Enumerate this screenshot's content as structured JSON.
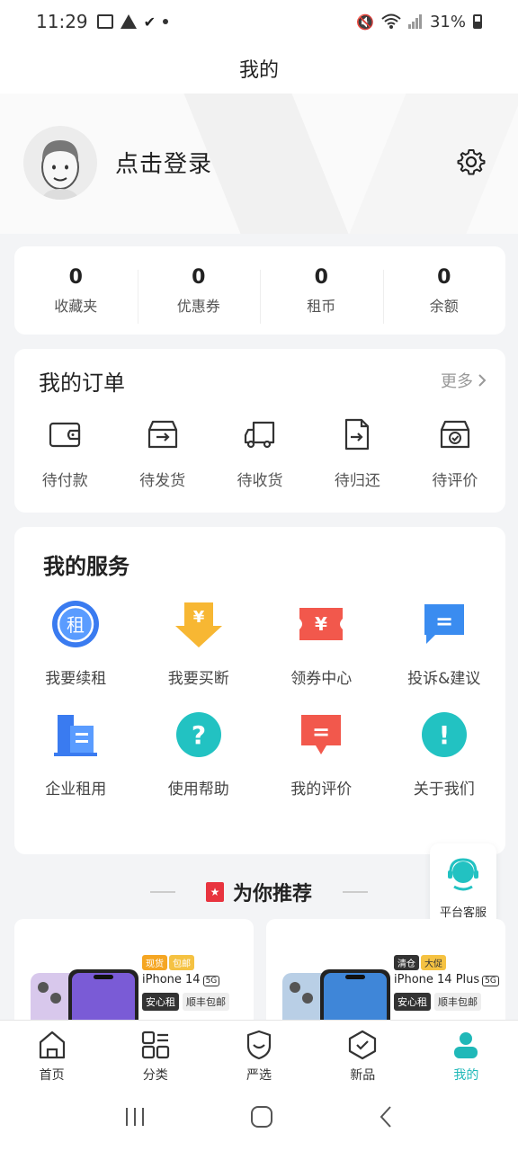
{
  "status_bar": {
    "time": "11:29",
    "battery": "31%"
  },
  "header": {
    "title": "我的"
  },
  "profile": {
    "login_label": "点击登录"
  },
  "stats": [
    {
      "value": "0",
      "label": "收藏夹"
    },
    {
      "value": "0",
      "label": "优惠券"
    },
    {
      "value": "0",
      "label": "租币"
    },
    {
      "value": "0",
      "label": "余额"
    }
  ],
  "orders": {
    "title": "我的订单",
    "more": "更多",
    "items": [
      {
        "label": "待付款",
        "icon": "wallet-icon"
      },
      {
        "label": "待发货",
        "icon": "box-icon"
      },
      {
        "label": "待收货",
        "icon": "truck-icon"
      },
      {
        "label": "待归还",
        "icon": "return-doc-icon"
      },
      {
        "label": "待评价",
        "icon": "review-box-icon"
      }
    ]
  },
  "services": {
    "title": "我的服务",
    "items": [
      {
        "label": "我要续租",
        "icon": "renew-icon",
        "glyph": "租",
        "color": "#3a7bf0"
      },
      {
        "label": "我要买断",
        "icon": "buyout-icon",
        "glyph": "¥",
        "color": "#f5a623"
      },
      {
        "label": "领券中心",
        "icon": "coupon-icon",
        "glyph": "¥",
        "color": "#f2584c"
      },
      {
        "label": "投诉&建议",
        "icon": "feedback-icon",
        "glyph": "=",
        "color": "#3a8cf0"
      },
      {
        "label": "企业租用",
        "icon": "enterprise-icon",
        "glyph": "",
        "color": "#3a7bf0"
      },
      {
        "label": "使用帮助",
        "icon": "help-icon",
        "glyph": "?",
        "color": "#22c2c2"
      },
      {
        "label": "我的评价",
        "icon": "my-review-icon",
        "glyph": "=",
        "color": "#f2584c"
      },
      {
        "label": "关于我们",
        "icon": "about-icon",
        "glyph": "!",
        "color": "#22c2c2"
      }
    ]
  },
  "recommend": {
    "title": "为你推荐",
    "products": [
      {
        "tags": [
          "现货",
          "包邮"
        ],
        "name": "iPhone 14",
        "net": "5G",
        "chip1": "安心租",
        "chip2": "顺丰包邮"
      },
      {
        "tags": [
          "清仓",
          "大促"
        ],
        "name": "iPhone 14 Plus",
        "net": "5G",
        "chip1": "安心租",
        "chip2": "顺丰包邮"
      }
    ]
  },
  "float_service": {
    "label": "平台客服"
  },
  "tabbar": [
    {
      "label": "首页",
      "icon": "home-icon"
    },
    {
      "label": "分类",
      "icon": "category-icon"
    },
    {
      "label": "严选",
      "icon": "shield-icon"
    },
    {
      "label": "新品",
      "icon": "new-badge-icon"
    },
    {
      "label": "我的",
      "icon": "user-icon",
      "active": true
    }
  ],
  "colors": {
    "accent": "#1fb8b8",
    "tab_active": "#1fb8b8"
  }
}
